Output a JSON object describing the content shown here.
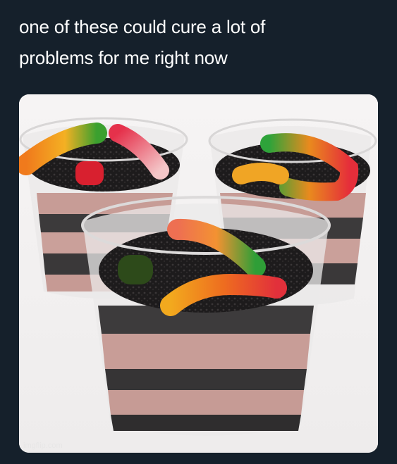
{
  "tweet": {
    "text": "one of these could cure a lot of\nproblems for me right now"
  },
  "photo": {
    "subject": "dirt-pudding-cups-with-gummy-worms"
  },
  "watermark": {
    "text": "imgflip.com"
  },
  "colors": {
    "background": "#15202b",
    "text": "#ffffff"
  }
}
